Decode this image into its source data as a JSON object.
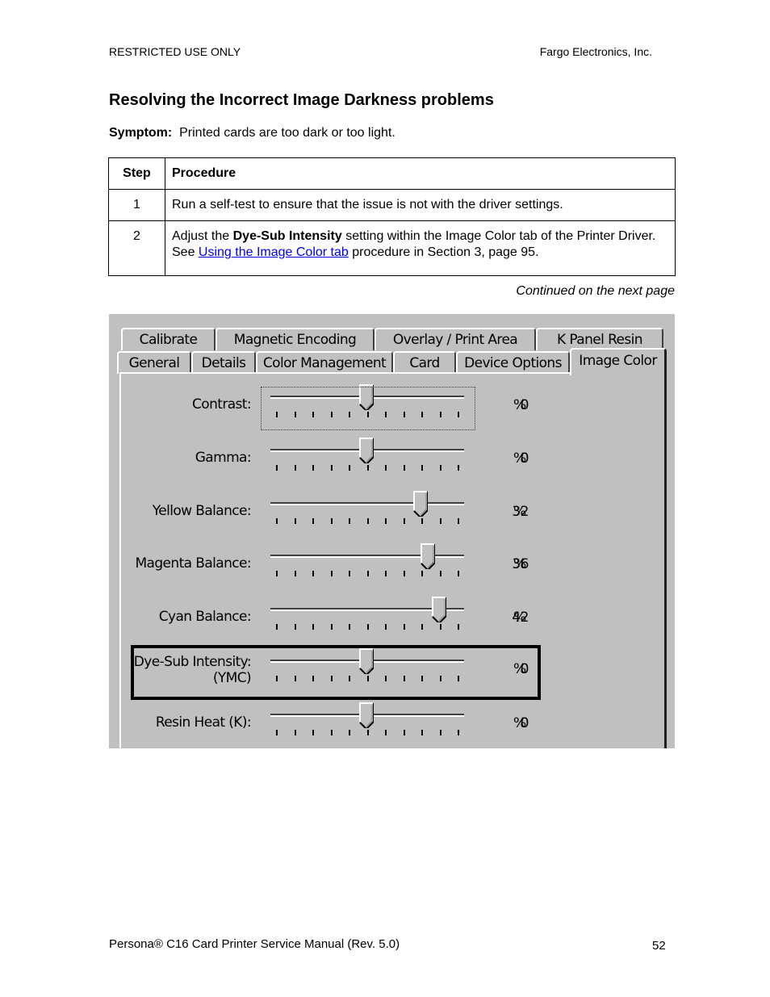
{
  "header": {
    "left": "RESTRICTED USE ONLY",
    "right": "Fargo Electronics, Inc."
  },
  "title": "Resolving the Incorrect Image Darkness problems",
  "symptom": {
    "label": "Symptom:",
    "text": "Printed cards are too dark or too light."
  },
  "table": {
    "headers": [
      "Step",
      "Procedure"
    ],
    "rows": [
      {
        "step": "1",
        "text": "Run a self-test to ensure that the issue is not with the driver settings."
      },
      {
        "step": "2",
        "text_before": "Adjust the ",
        "bold": "Dye-Sub Intensity",
        "text_middle": " setting within the Image Color tab of the Printer Driver. See ",
        "link": "Using the Image Color tab",
        "text_after": " procedure in Section 3, page 95."
      }
    ]
  },
  "continued": "Continued on the next page",
  "dialog": {
    "tabs_back": [
      "Calibrate",
      "Magnetic Encoding",
      "Overlay / Print Area",
      "K Panel Resin"
    ],
    "tabs_front": [
      "General",
      "Details",
      "Color Management",
      "Card",
      "Device Options",
      "Image Color"
    ],
    "active_tab": "Image Color",
    "sliders": [
      {
        "label": "Contrast:",
        "value": "0",
        "unit": "%",
        "position": 0.5,
        "focused": true
      },
      {
        "label": "Gamma:",
        "value": "0",
        "unit": "%",
        "position": 0.5
      },
      {
        "label": "Yellow Balance:",
        "value": "32",
        "unit": "%",
        "position": 0.8
      },
      {
        "label": "Magenta Balance:",
        "value": "36",
        "unit": "%",
        "position": 0.84
      },
      {
        "label": "Cyan Balance:",
        "value": "42",
        "unit": "%",
        "position": 0.9
      },
      {
        "label": "Dye-Sub Intensity:",
        "sublabel": "(YMC)",
        "value": "0",
        "unit": "%",
        "position": 0.5,
        "highlighted": true
      },
      {
        "label": "Resin Heat  (K):",
        "value": "0",
        "unit": "%",
        "position": 0.5
      }
    ]
  },
  "footer": {
    "left": "Persona® C16 Card Printer Service Manual (Rev. 5.0)",
    "page": "52"
  }
}
